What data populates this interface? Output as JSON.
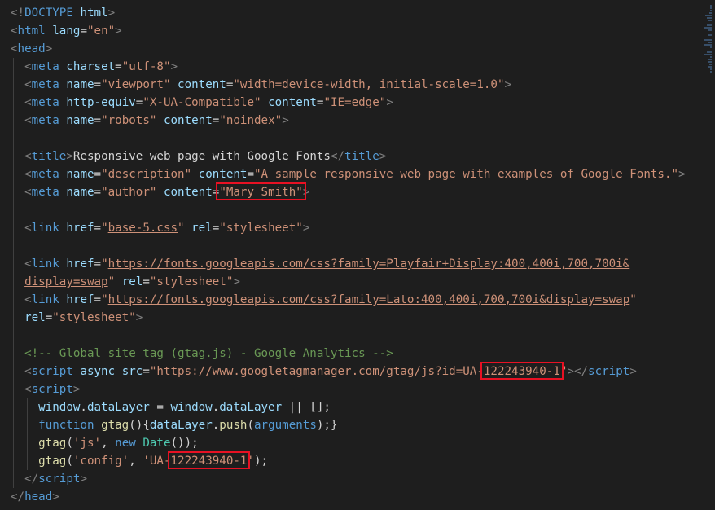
{
  "editor": {
    "lines": [
      {
        "indent": 0,
        "tokens": [
          [
            "punct",
            "<!"
          ],
          [
            "doctype",
            "DOCTYPE"
          ],
          [
            "text",
            " "
          ],
          [
            "attr",
            "html"
          ],
          [
            "punct",
            ">"
          ]
        ]
      },
      {
        "indent": 0,
        "tokens": [
          [
            "punct",
            "<"
          ],
          [
            "tag",
            "html"
          ],
          [
            "text",
            " "
          ],
          [
            "attr",
            "lang"
          ],
          [
            "text",
            "="
          ],
          [
            "str",
            "\"en\""
          ],
          [
            "punct",
            ">"
          ]
        ]
      },
      {
        "indent": 0,
        "tokens": [
          [
            "punct",
            "<"
          ],
          [
            "tag",
            "head"
          ],
          [
            "punct",
            ">"
          ]
        ]
      },
      {
        "indent": 1,
        "tokens": [
          [
            "punct",
            "<"
          ],
          [
            "tag",
            "meta"
          ],
          [
            "text",
            " "
          ],
          [
            "attr",
            "charset"
          ],
          [
            "text",
            "="
          ],
          [
            "str",
            "\"utf-8\""
          ],
          [
            "punct",
            ">"
          ]
        ]
      },
      {
        "indent": 1,
        "tokens": [
          [
            "punct",
            "<"
          ],
          [
            "tag",
            "meta"
          ],
          [
            "text",
            " "
          ],
          [
            "attr",
            "name"
          ],
          [
            "text",
            "="
          ],
          [
            "str",
            "\"viewport\""
          ],
          [
            "text",
            " "
          ],
          [
            "attr",
            "content"
          ],
          [
            "text",
            "="
          ],
          [
            "str",
            "\"width=device-width, initial-scale=1.0\""
          ],
          [
            "punct",
            ">"
          ]
        ]
      },
      {
        "indent": 1,
        "tokens": [
          [
            "punct",
            "<"
          ],
          [
            "tag",
            "meta"
          ],
          [
            "text",
            " "
          ],
          [
            "attr",
            "http-equiv"
          ],
          [
            "text",
            "="
          ],
          [
            "str",
            "\"X-UA-Compatible\""
          ],
          [
            "text",
            " "
          ],
          [
            "attr",
            "content"
          ],
          [
            "text",
            "="
          ],
          [
            "str",
            "\"IE=edge\""
          ],
          [
            "punct",
            ">"
          ]
        ]
      },
      {
        "indent": 1,
        "tokens": [
          [
            "punct",
            "<"
          ],
          [
            "tag",
            "meta"
          ],
          [
            "text",
            " "
          ],
          [
            "attr",
            "name"
          ],
          [
            "text",
            "="
          ],
          [
            "str",
            "\"robots\""
          ],
          [
            "text",
            " "
          ],
          [
            "attr",
            "content"
          ],
          [
            "text",
            "="
          ],
          [
            "str",
            "\"noindex\""
          ],
          [
            "punct",
            ">"
          ]
        ]
      },
      {
        "indent": 1,
        "tokens": []
      },
      {
        "indent": 1,
        "tokens": [
          [
            "punct",
            "<"
          ],
          [
            "tag",
            "title"
          ],
          [
            "punct",
            ">"
          ],
          [
            "text",
            "Responsive web page with Google Fonts"
          ],
          [
            "punct",
            "</"
          ],
          [
            "tag",
            "title"
          ],
          [
            "punct",
            ">"
          ]
        ]
      },
      {
        "indent": 1,
        "tokens": [
          [
            "punct",
            "<"
          ],
          [
            "tag",
            "meta"
          ],
          [
            "text",
            " "
          ],
          [
            "attr",
            "name"
          ],
          [
            "text",
            "="
          ],
          [
            "str",
            "\"description\""
          ],
          [
            "text",
            " "
          ],
          [
            "attr",
            "content"
          ],
          [
            "text",
            "="
          ],
          [
            "str",
            "\"A sample responsive web page with examples of Google Fonts.\""
          ],
          [
            "punct",
            ">"
          ]
        ]
      },
      {
        "indent": 1,
        "tokens": [
          [
            "punct",
            "<"
          ],
          [
            "tag",
            "meta"
          ],
          [
            "text",
            " "
          ],
          [
            "attr",
            "name"
          ],
          [
            "text",
            "="
          ],
          [
            "str",
            "\"author\""
          ],
          [
            "text",
            " "
          ],
          [
            "attr",
            "content"
          ],
          [
            "text",
            "="
          ],
          [
            "str",
            "\"Mary Smith\"",
            "hl-author"
          ],
          [
            "punct",
            ">"
          ]
        ]
      },
      {
        "indent": 1,
        "tokens": []
      },
      {
        "indent": 1,
        "tokens": [
          [
            "punct",
            "<"
          ],
          [
            "tag",
            "link"
          ],
          [
            "text",
            " "
          ],
          [
            "attr",
            "href"
          ],
          [
            "text",
            "="
          ],
          [
            "str",
            "\""
          ],
          [
            "link",
            "base-5.css"
          ],
          [
            "str",
            "\""
          ],
          [
            "text",
            " "
          ],
          [
            "attr",
            "rel"
          ],
          [
            "text",
            "="
          ],
          [
            "str",
            "\"stylesheet\""
          ],
          [
            "punct",
            ">"
          ]
        ]
      },
      {
        "indent": 1,
        "tokens": []
      },
      {
        "indent": 1,
        "tokens": [
          [
            "punct",
            "<"
          ],
          [
            "tag",
            "link"
          ],
          [
            "text",
            " "
          ],
          [
            "attr",
            "href"
          ],
          [
            "text",
            "="
          ],
          [
            "str",
            "\""
          ],
          [
            "link",
            "https://fonts.googleapis.com/css?family=Playfair+Display:400,400i,700,700i&"
          ]
        ]
      },
      {
        "indent": 1,
        "tokens": [
          [
            "link",
            "display=swap"
          ],
          [
            "str",
            "\""
          ],
          [
            "text",
            " "
          ],
          [
            "attr",
            "rel"
          ],
          [
            "text",
            "="
          ],
          [
            "str",
            "\"stylesheet\""
          ],
          [
            "punct",
            ">"
          ]
        ]
      },
      {
        "indent": 1,
        "tokens": [
          [
            "punct",
            "<"
          ],
          [
            "tag",
            "link"
          ],
          [
            "text",
            " "
          ],
          [
            "attr",
            "href"
          ],
          [
            "text",
            "="
          ],
          [
            "str",
            "\""
          ],
          [
            "link",
            "https://fonts.googleapis.com/css?family=Lato:400,400i,700,700i&display=swap"
          ],
          [
            "str",
            "\""
          ]
        ]
      },
      {
        "indent": 1,
        "tokens": [
          [
            "attr",
            "rel"
          ],
          [
            "text",
            "="
          ],
          [
            "str",
            "\"stylesheet\""
          ],
          [
            "punct",
            ">"
          ]
        ]
      },
      {
        "indent": 1,
        "tokens": []
      },
      {
        "indent": 1,
        "tokens": [
          [
            "comment",
            "<!-- Global site tag (gtag.js) - Google Analytics -->"
          ]
        ]
      },
      {
        "indent": 1,
        "tokens": [
          [
            "punct",
            "<"
          ],
          [
            "tag",
            "script"
          ],
          [
            "text",
            " "
          ],
          [
            "attr",
            "async"
          ],
          [
            "text",
            " "
          ],
          [
            "attr",
            "src"
          ],
          [
            "text",
            "="
          ],
          [
            "str",
            "\""
          ],
          [
            "link",
            "https://www.googletagmanager.com/gtag/js?id=UA-"
          ],
          [
            "link",
            "122243940-1",
            "hl-id1"
          ],
          [
            "str",
            "\""
          ],
          [
            "punct",
            "></"
          ],
          [
            "tag",
            "script"
          ],
          [
            "punct",
            ">"
          ]
        ]
      },
      {
        "indent": 1,
        "tokens": [
          [
            "punct",
            "<"
          ],
          [
            "tag",
            "script"
          ],
          [
            "punct",
            ">"
          ]
        ]
      },
      {
        "indent": 2,
        "tokens": [
          [
            "var",
            "window"
          ],
          [
            "text",
            "."
          ],
          [
            "var",
            "dataLayer"
          ],
          [
            "text",
            " = "
          ],
          [
            "var",
            "window"
          ],
          [
            "text",
            "."
          ],
          [
            "var",
            "dataLayer"
          ],
          [
            "text",
            " || [];"
          ]
        ]
      },
      {
        "indent": 2,
        "tokens": [
          [
            "kw",
            "function"
          ],
          [
            "text",
            " "
          ],
          [
            "fn",
            "gtag"
          ],
          [
            "text",
            "(){"
          ],
          [
            "var",
            "dataLayer"
          ],
          [
            "text",
            "."
          ],
          [
            "fn",
            "push"
          ],
          [
            "text",
            "("
          ],
          [
            "kw",
            "arguments"
          ],
          [
            "text",
            ");}"
          ]
        ]
      },
      {
        "indent": 2,
        "tokens": [
          [
            "fn",
            "gtag"
          ],
          [
            "text",
            "("
          ],
          [
            "str",
            "'js'"
          ],
          [
            "text",
            ", "
          ],
          [
            "kw",
            "new"
          ],
          [
            "text",
            " "
          ],
          [
            "cls",
            "Date"
          ],
          [
            "text",
            "());"
          ]
        ]
      },
      {
        "indent": 2,
        "tokens": [
          [
            "fn",
            "gtag"
          ],
          [
            "text",
            "("
          ],
          [
            "str",
            "'config'"
          ],
          [
            "text",
            ", "
          ],
          [
            "str",
            "'UA-"
          ],
          [
            "str",
            "122243940-1",
            "hl-id2"
          ],
          [
            "str",
            "'"
          ],
          [
            "text",
            ");"
          ]
        ]
      },
      {
        "indent": 1,
        "tokens": [
          [
            "punct",
            "</"
          ],
          [
            "tag",
            "script"
          ],
          [
            "punct",
            ">"
          ]
        ]
      },
      {
        "indent": 0,
        "tokens": [
          [
            "punct",
            "</"
          ],
          [
            "tag",
            "head"
          ],
          [
            "punct",
            ">"
          ]
        ]
      }
    ]
  }
}
